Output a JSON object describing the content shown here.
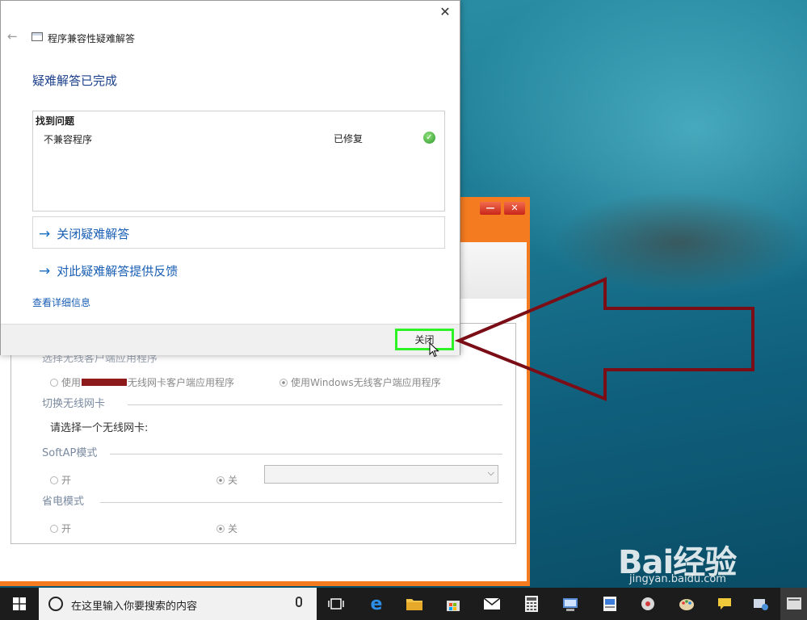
{
  "dialog": {
    "title": "程序兼容性疑难解答",
    "heading": "疑难解答已完成",
    "found_header": "找到问题",
    "issue_name": "不兼容程序",
    "issue_status": "已修复",
    "link_close": "关闭疑难解答",
    "link_feedback": "对此疑难解答提供反馈",
    "link_details": "查看详细信息",
    "close_button": "关闭"
  },
  "bg_app": {
    "section_partial": "选择无线客户端应用程序",
    "radio_vendor_prefix": "使用",
    "radio_vendor_suffix": "无线网卡客户端应用程序",
    "radio_windows": "使用Windows无线客户端应用程序",
    "section_switch": "切换无线网卡",
    "select_label": "请选择一个无线网卡:",
    "section_softap": "SoftAP模式",
    "on_label": "开",
    "off_label": "关",
    "section_power": "省电模式"
  },
  "taskbar": {
    "search_placeholder": "在这里输入你要搜索的内容"
  },
  "watermark": {
    "logo": "Bai经验",
    "url": "jingyan.baidu.com"
  },
  "colors": {
    "accent_orange": "#f47b20",
    "highlight_green": "#2cf226",
    "annotation_red": "#7b0d16",
    "link_blue": "#1a5fb4"
  }
}
